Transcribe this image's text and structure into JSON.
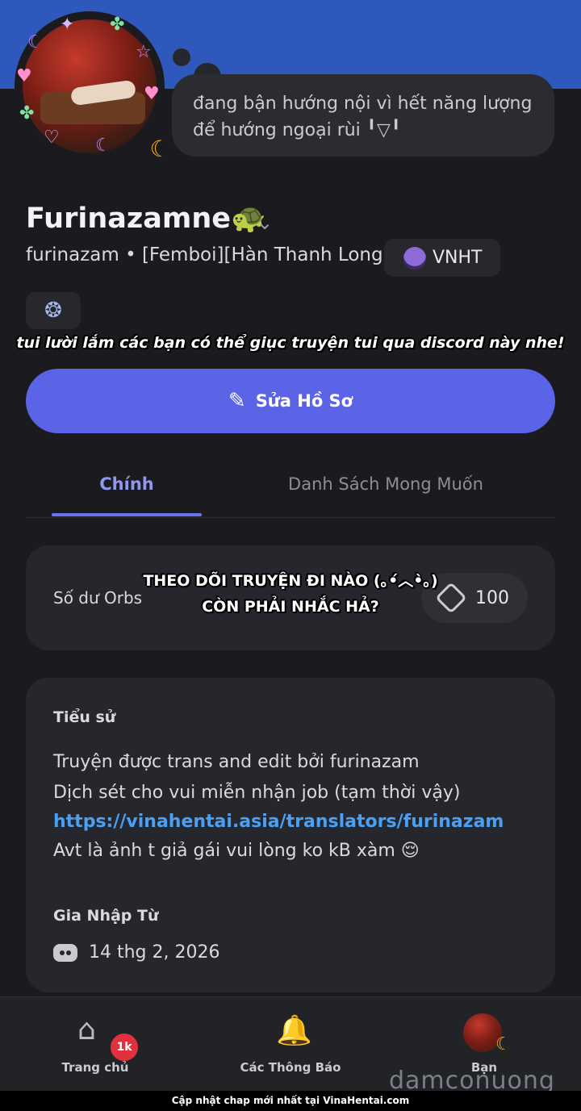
{
  "profile": {
    "status_text": "đang bận hướng nội vì hết năng lượng để hướng ngoại rùi ╹▽╹",
    "display_name": "Furinazamne🐢",
    "subtitle": "furinazam • [Femboi][Hàn Thanh Long]",
    "server_tag": "VNHT",
    "avatar_icon": "moon-icon"
  },
  "overlay": {
    "top_note": "tui lười lắm các bạn có thể giục truyện tui qua discord này nhe!",
    "orbs_note_1": "THEO DÕI TRUYỆN ĐI NÀO (｡•́︿•̀｡)",
    "orbs_note_2": "CÒN PHẢI NHẮC HẢ?"
  },
  "actions": {
    "edit_profile": "Sửa Hồ Sơ"
  },
  "tabs": [
    {
      "label": "Chính",
      "active": true
    },
    {
      "label": "Danh Sách Mong Muốn",
      "active": false
    }
  ],
  "orbs": {
    "label": "Số dư Orbs",
    "value": "100"
  },
  "bio": {
    "title": "Tiểu sử",
    "lines": [
      "Truyện được trans and edit bởi furinazam",
      "Dịch sét cho vui miễn nhận job (tạm thời vậy)",
      "https://vinahentai.asia/translators/furinazam",
      "Avt là ảnh t giả gái vui lòng ko kB xàm 😌"
    ],
    "join_title": "Gia Nhập Từ",
    "join_date": "14 thg 2, 2026"
  },
  "nav": {
    "home": "Trang chủ",
    "home_badge": "1k",
    "notifications": "Các Thông Báo",
    "you": "Bạn"
  },
  "watermark": "damconuong",
  "footer": "Cập nhật chap mới nhất tại VinaHentai.com",
  "colors": {
    "banner": "#2f58bd",
    "accent": "#5b63e7",
    "link": "#4aa0f4",
    "badge": "#e1313d"
  }
}
